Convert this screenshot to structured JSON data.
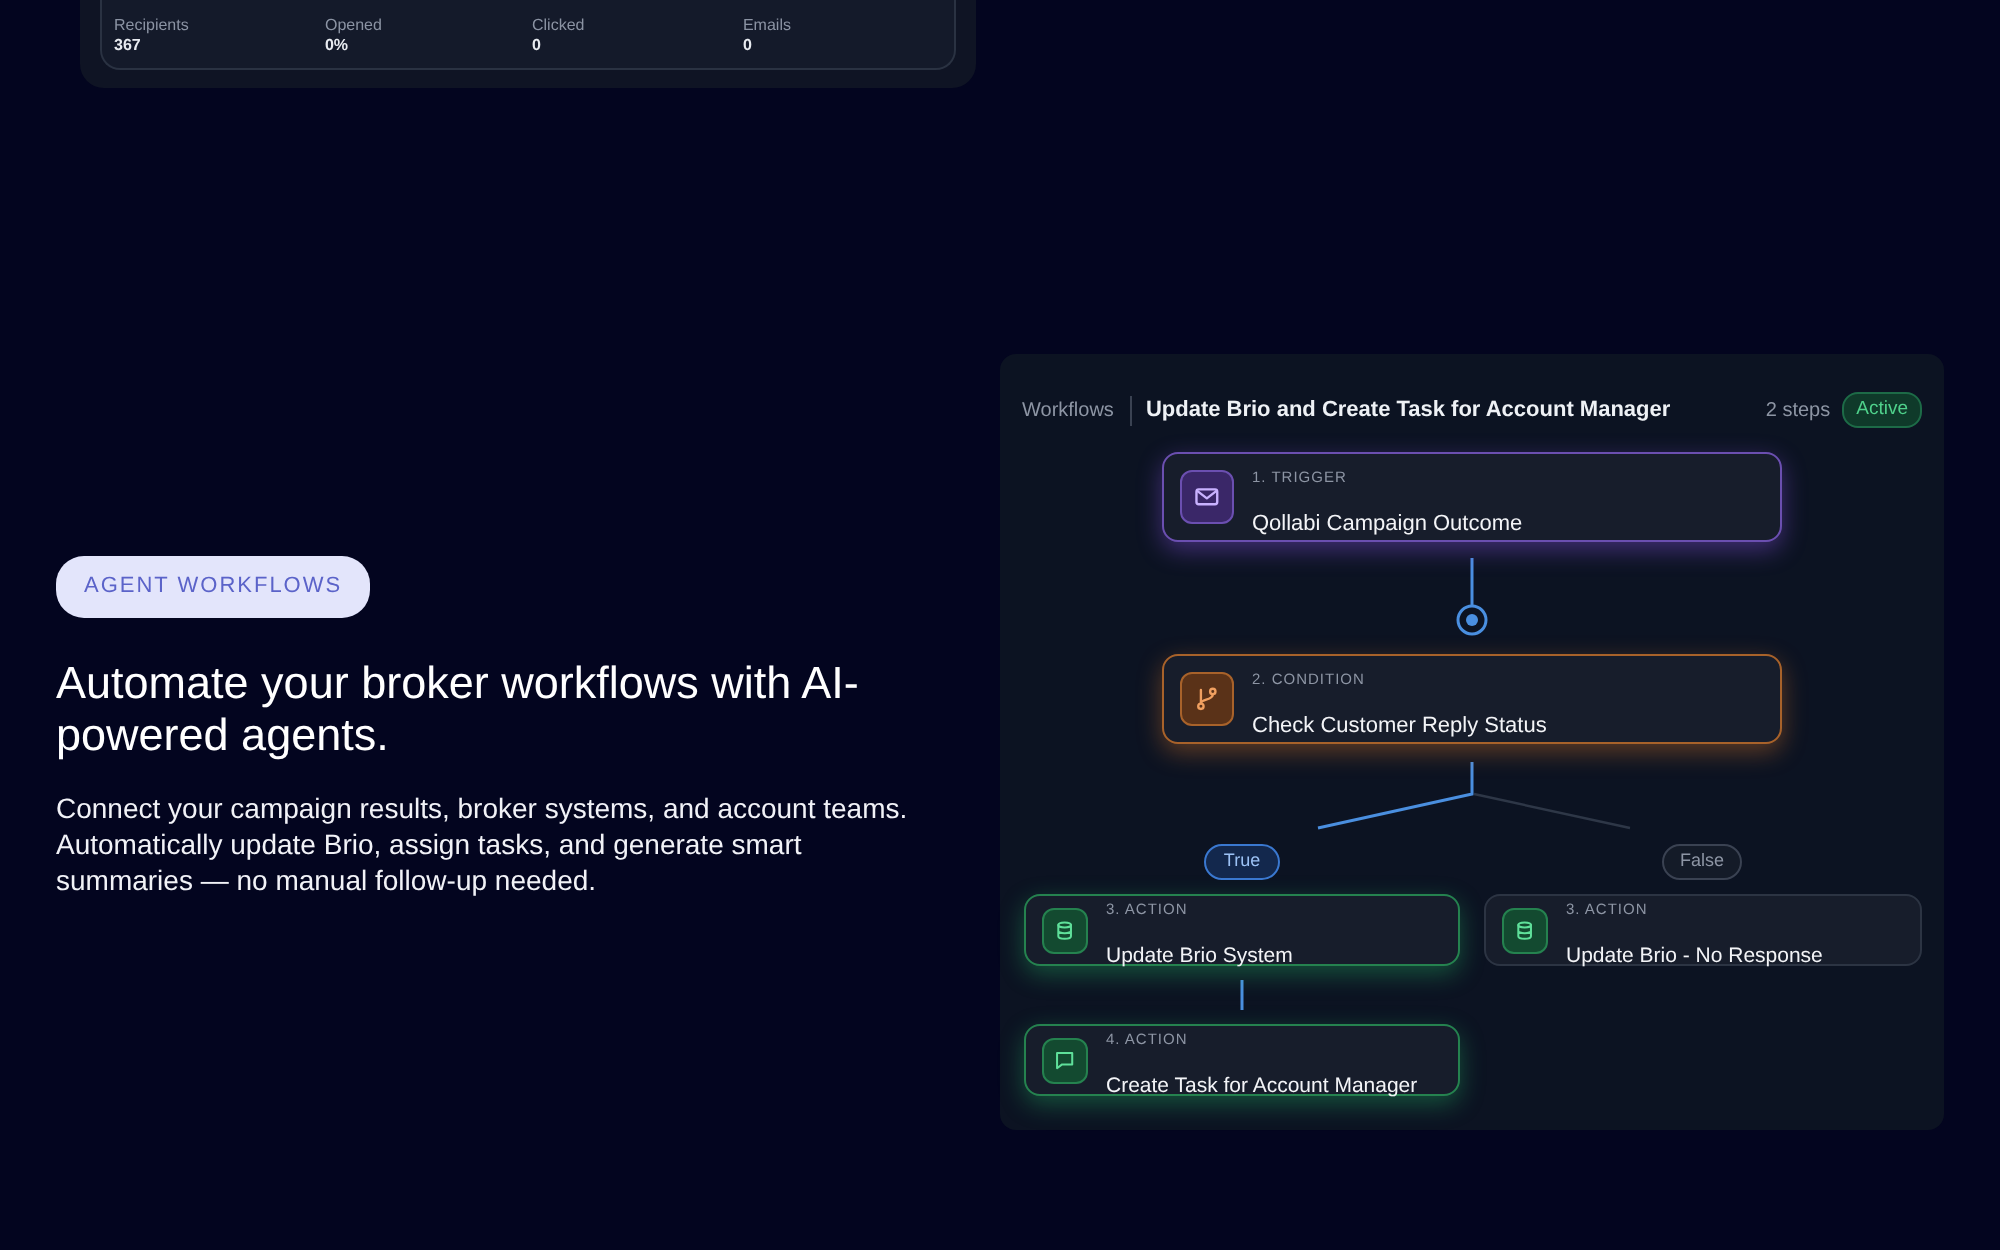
{
  "campaign_stats": [
    {
      "label": "Recipients",
      "value": "367"
    },
    {
      "label": "Opened",
      "value": "0%"
    },
    {
      "label": "Clicked",
      "value": "0"
    },
    {
      "label": "Emails",
      "value": "0"
    }
  ],
  "section": {
    "badge": "AGENT WORKFLOWS",
    "heading": "Automate your broker workflows with AI-powered agents.",
    "body": "Connect your campaign results, broker systems, and account teams. Automatically update Brio, assign tasks, and generate smart  summaries — no manual follow-up needed."
  },
  "workflow": {
    "breadcrumb": "Workflows",
    "title": "Update Brio and Create Task for Account Manager",
    "steps": "2 steps",
    "status": "Active",
    "nodes": [
      {
        "kind": "trigger",
        "label": "1. TRIGGER",
        "title": "Qollabi Campaign Outcome",
        "highlighted": true
      },
      {
        "kind": "condition",
        "label": "2. CONDITION",
        "title": "Check Customer Reply Status",
        "highlighted": true
      },
      {
        "kind": "action",
        "label": "3. ACTION",
        "title": "Update Brio System",
        "highlighted": true
      },
      {
        "kind": "action",
        "label": "3. ACTION",
        "title": "Update Brio - No Response",
        "highlighted": false
      },
      {
        "kind": "task",
        "label": "4. ACTION",
        "title": "Create Task for Account Manager",
        "highlighted": true
      }
    ],
    "branches": [
      {
        "label": "True",
        "selected": true
      },
      {
        "label": "False",
        "selected": false
      }
    ]
  }
}
